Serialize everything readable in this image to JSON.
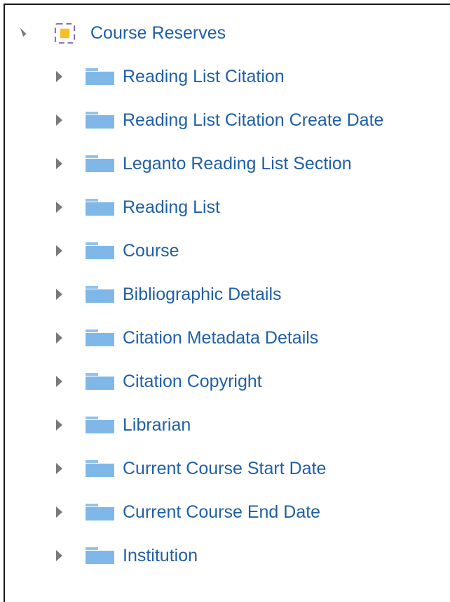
{
  "tree": {
    "root": {
      "label": "Course Reserves",
      "icon": "subject-area-icon",
      "expanded": true
    },
    "items": [
      {
        "label": "Reading List Citation",
        "icon": "folder-icon"
      },
      {
        "label": "Reading List Citation Create Date",
        "icon": "folder-icon"
      },
      {
        "label": "Leganto Reading List Section",
        "icon": "folder-icon"
      },
      {
        "label": "Reading List",
        "icon": "folder-icon"
      },
      {
        "label": "Course",
        "icon": "folder-icon"
      },
      {
        "label": "Bibliographic Details",
        "icon": "folder-icon"
      },
      {
        "label": "Citation Metadata Details",
        "icon": "folder-icon"
      },
      {
        "label": "Citation Copyright",
        "icon": "folder-icon"
      },
      {
        "label": "Librarian",
        "icon": "folder-icon"
      },
      {
        "label": "Current Course Start Date",
        "icon": "folder-icon"
      },
      {
        "label": "Current Course End Date",
        "icon": "folder-icon"
      },
      {
        "label": "Institution",
        "icon": "folder-icon"
      }
    ]
  },
  "colors": {
    "label": "#1f5fa8",
    "folder": "#7fb8e8",
    "folder_tab": "#8fc3ee",
    "toggle": "#7a7a7a",
    "root_icon_frame": "#8d62b8",
    "root_icon_fill": "#f5c026"
  }
}
